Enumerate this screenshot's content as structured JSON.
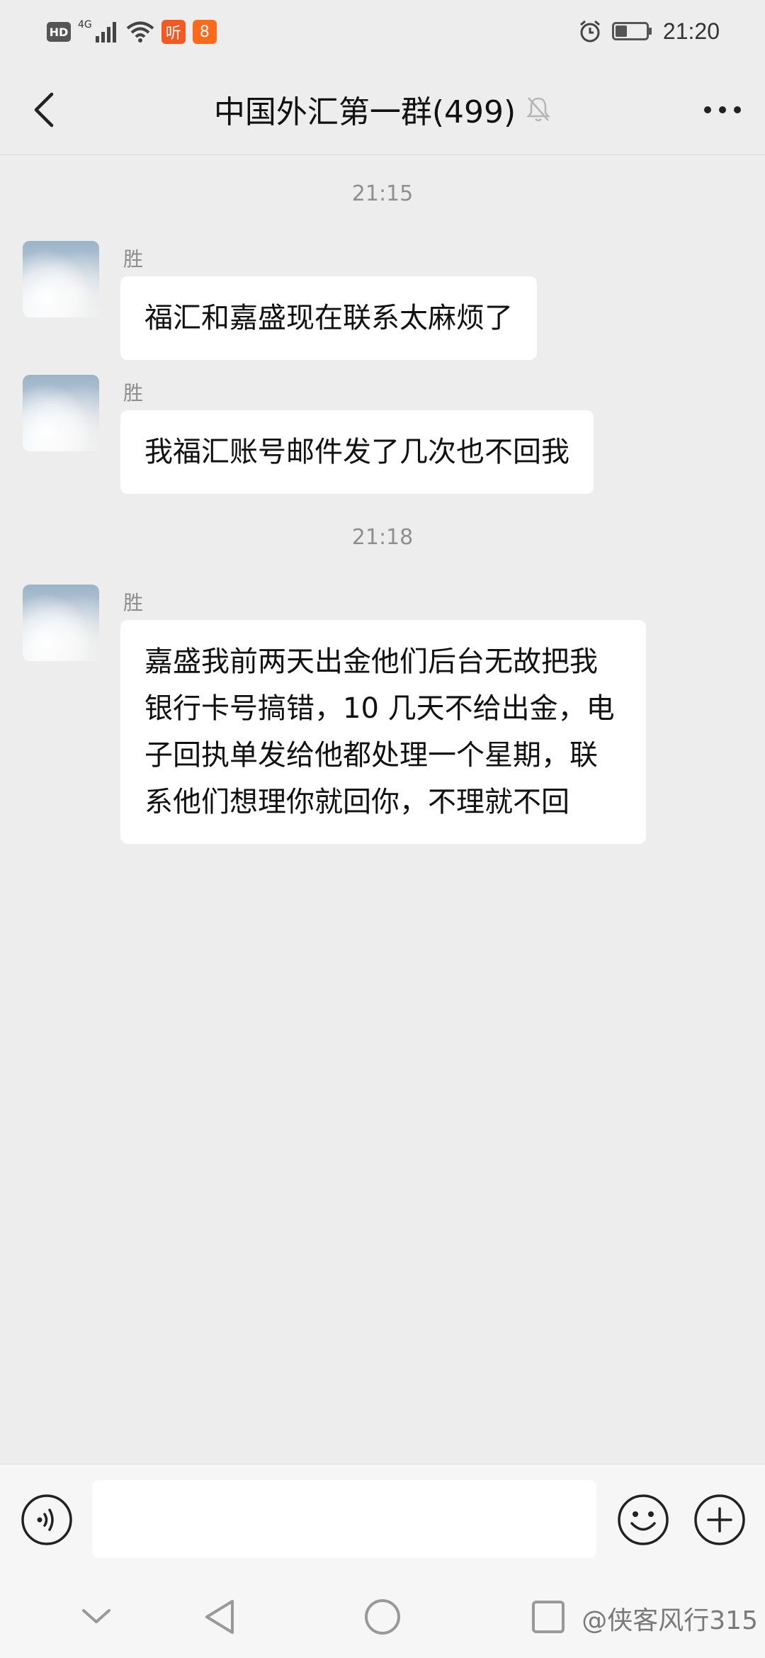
{
  "status_bar": {
    "hd": "HD",
    "network": "4G",
    "app_badge_1": "听",
    "app_badge_2": "8",
    "time": "21:20"
  },
  "header": {
    "title": "中国外汇第一群(499)"
  },
  "timestamps": [
    "21:15",
    "21:18"
  ],
  "messages": [
    {
      "sender": "胜",
      "text": "福汇和嘉盛现在联系太麻烦了"
    },
    {
      "sender": "胜",
      "text": "我福汇账号邮件发了几次也不回我"
    },
    {
      "sender": "胜",
      "text": "嘉盛我前两天出金他们后台无故把我银行卡号搞错，10 几天不给出金，电子回执单发给他都处理一个星期，联系他们想理你就回你，不理就不回"
    }
  ],
  "input": {
    "value": "",
    "placeholder": ""
  },
  "watermark": "@侠客风行315"
}
